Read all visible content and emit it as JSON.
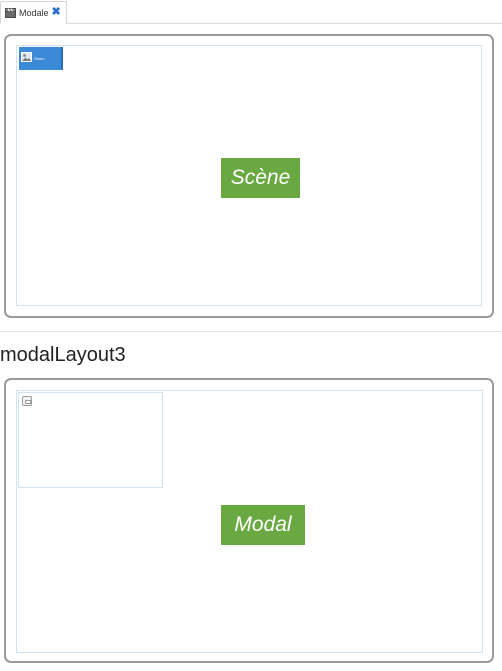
{
  "tabs": [
    {
      "label": "Modale",
      "icon": "clapperboard-icon",
      "close_glyph": "✖"
    }
  ],
  "scene": {
    "badge_label": "Scène",
    "item": {
      "label": "Gwnn",
      "icon": "image-icon"
    }
  },
  "layout_title": "modalLayout3",
  "modal": {
    "badge_label": "Modal",
    "window_icon": "window-icon"
  },
  "colors": {
    "badge_green": "#6aa842",
    "item_blue": "#3a8ad8",
    "close_blue": "#2b73c9",
    "panel_border": "#9a9a9a",
    "inner_border": "#cfe3f3"
  }
}
